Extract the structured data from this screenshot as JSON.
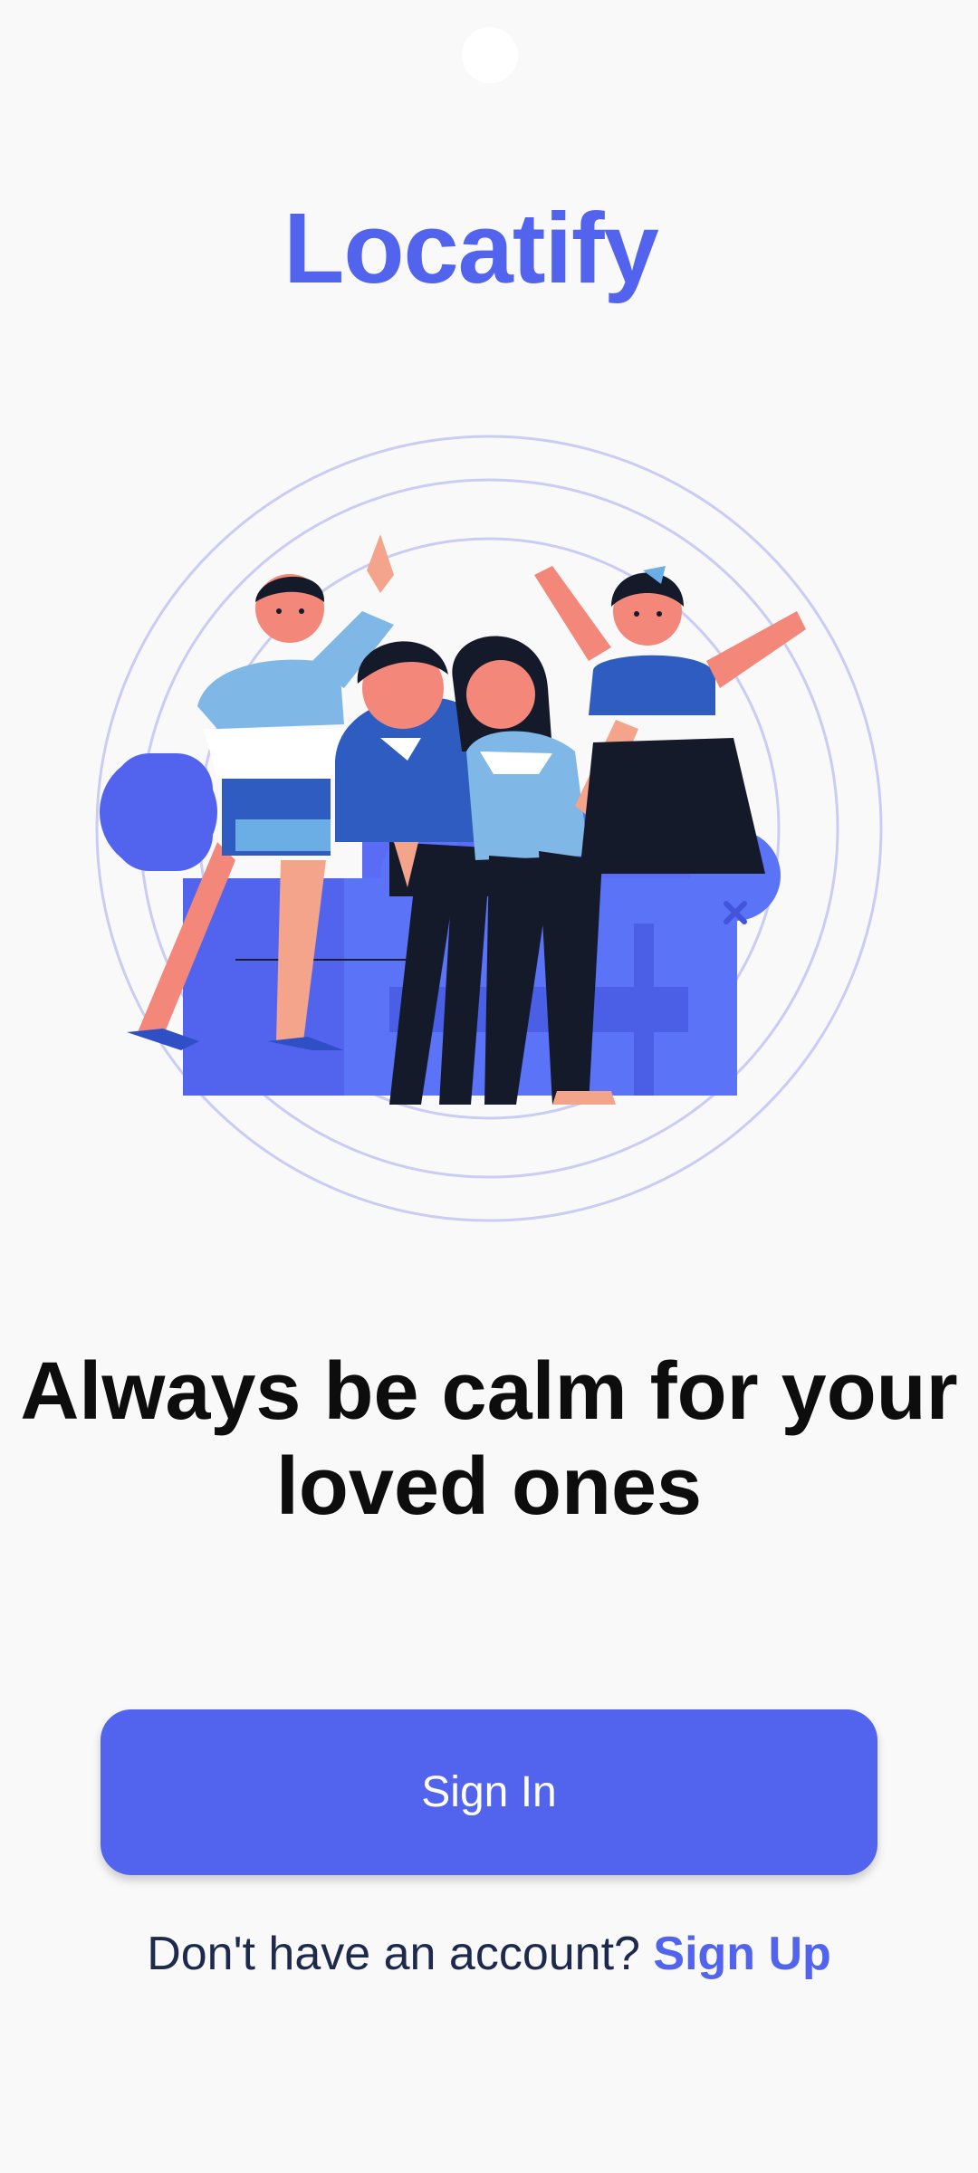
{
  "app": {
    "title": "Locatify"
  },
  "hero": {
    "illustration_icon": "family-on-couch-illustration",
    "headline_line1": "Always be calm for your",
    "headline_line2": "loved ones"
  },
  "actions": {
    "signin_label": "Sign In",
    "signup_prompt": "Don't have an account?",
    "signup_link": "Sign Up"
  },
  "colors": {
    "accent": "#5264ee",
    "background": "#f9f9f9",
    "headline": "#0d0d0d",
    "prompt_text": "#1d2a4e"
  }
}
